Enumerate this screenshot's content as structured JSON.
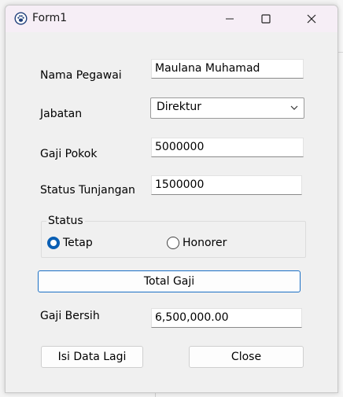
{
  "window": {
    "title": "Form1",
    "icons": {
      "app": "paw-icon",
      "minimize": "minimize-icon",
      "maximize": "maximize-icon",
      "close": "close-icon"
    }
  },
  "form": {
    "nama_pegawai": {
      "label": "Nama Pegawai",
      "value": "Maulana Muhamad"
    },
    "jabatan": {
      "label": "Jabatan",
      "selected": "Direktur",
      "icon": "chevron-down-icon"
    },
    "gaji_pokok": {
      "label": "Gaji Pokok",
      "value": "5000000"
    },
    "status_tunjangan": {
      "label": "Status Tunjangan",
      "value": "1500000"
    },
    "status": {
      "title": "Status",
      "options": [
        {
          "label": "Tetap",
          "checked": true
        },
        {
          "label": "Honorer",
          "checked": false
        }
      ]
    },
    "total_gaji_button": "Total Gaji",
    "gaji_bersih": {
      "label": "Gaji Bersih",
      "value": "6,500,000.00"
    },
    "isi_data_lagi_button": "Isi Data Lagi",
    "close_button": "Close"
  },
  "colors": {
    "accent": "#0a5fb4",
    "titlebar": "#f6eef6",
    "window_bg": "#f0f0f0",
    "primary_button_border": "#1a6fc4"
  }
}
